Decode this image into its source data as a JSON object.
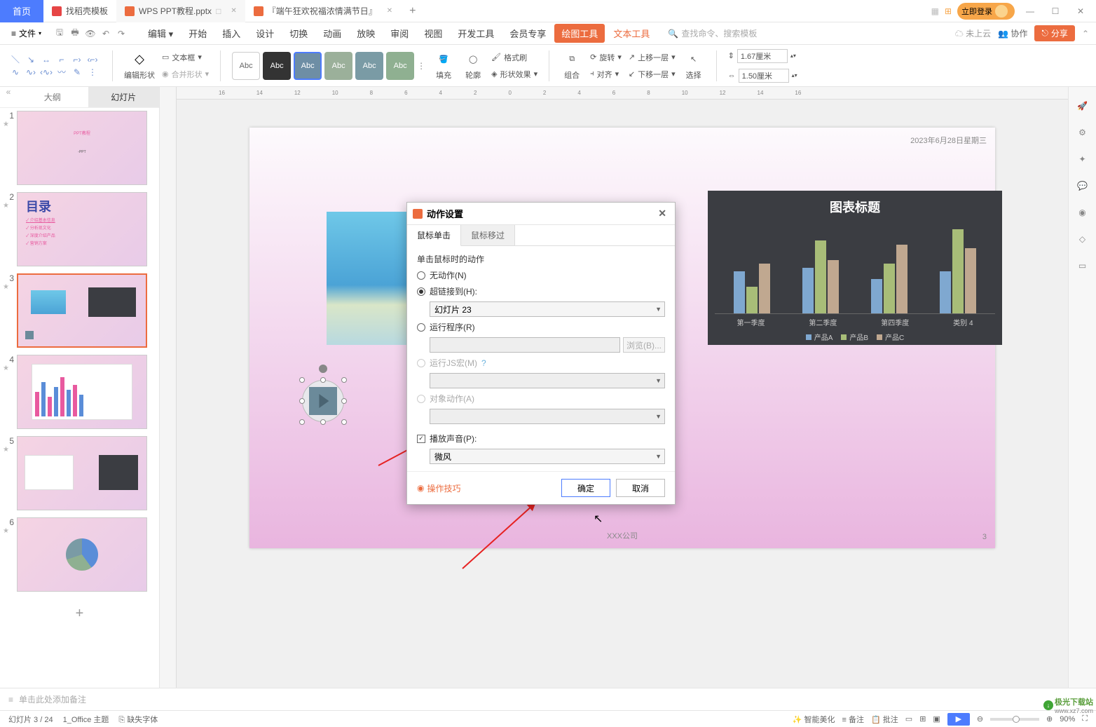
{
  "titlebar": {
    "home": "首页",
    "tabs": [
      {
        "label": "找稻壳模板"
      },
      {
        "label": "WPS PPT教程.pptx"
      },
      {
        "label": "『端午狂欢祝福浓情满节日』"
      }
    ],
    "login": "立即登录"
  },
  "menubar": {
    "file": "文件",
    "tabs": [
      "编辑",
      "开始",
      "插入",
      "设计",
      "切换",
      "动画",
      "放映",
      "审阅",
      "视图",
      "开发工具",
      "会员专享"
    ],
    "draw": "绘图工具",
    "text": "文本工具",
    "search_placeholder": "查找命令、搜索模板",
    "cloud": "未上云",
    "collab": "协作",
    "share": "分享"
  },
  "ribbon": {
    "edit_shape": "编辑形状",
    "textbox": "文本框",
    "merge_shape": "合并形状",
    "swatch_label": "Abc",
    "fill": "填充",
    "outline": "轮廓",
    "format_painter": "格式刷",
    "shape_effects": "形状效果",
    "group": "组合",
    "rotate": "旋转",
    "align": "对齐",
    "bring_forward": "上移一层",
    "send_backward": "下移一层",
    "select": "选择",
    "height": "1.67厘米",
    "width": "1.50厘米"
  },
  "side": {
    "tab_outline": "大纲",
    "tab_slides": "幻灯片",
    "mulu_title": "目录",
    "mulu_items": [
      "介绍基本信息",
      "分析现文化",
      "深度介绍产品",
      "营销方案"
    ],
    "add": "+"
  },
  "ruler": [
    "16",
    "14",
    "12",
    "10",
    "8",
    "6",
    "4",
    "2",
    "0",
    "2",
    "4",
    "6",
    "8",
    "10",
    "12",
    "14",
    "16"
  ],
  "slide": {
    "date": "2023年6月28日星期三",
    "company": "XXX公司",
    "page_num": "3"
  },
  "chart_data": {
    "type": "bar",
    "title": "图表标题",
    "categories": [
      "第一季度",
      "第二季度",
      "第四季度",
      "类别 4"
    ],
    "series": [
      {
        "name": "产品A",
        "values": [
          55,
          60,
          45,
          55
        ]
      },
      {
        "name": "产品B",
        "values": [
          35,
          95,
          65,
          110
        ]
      },
      {
        "name": "产品C",
        "values": [
          65,
          70,
          90,
          85
        ]
      }
    ],
    "legend": [
      "产品A",
      "产品B",
      "产品C"
    ]
  },
  "dialog": {
    "title": "动作设置",
    "tabs": [
      "鼠标单击",
      "鼠标移过"
    ],
    "section": "单击鼠标时的动作",
    "none": "无动作(N)",
    "hyperlink": "超链接到(H):",
    "hyperlink_value": "幻灯片 23",
    "run": "运行程序(R)",
    "browse": "浏览(B)...",
    "macro": "运行JS宏(M)",
    "object": "对象动作(A)",
    "sound": "播放声音(P):",
    "sound_value": "微风",
    "tips": "操作技巧",
    "ok": "确定",
    "cancel": "取消"
  },
  "notes": "单击此处添加备注",
  "status": {
    "slide_info": "幻灯片 3 / 24",
    "theme": "1_Office 主题",
    "missing_font": "缺失字体",
    "beautify": "智能美化",
    "note": "备注",
    "review": "批注",
    "zoom": "90%"
  },
  "watermark": {
    "site": "极光下载站",
    "url": "www.xz7.com"
  }
}
